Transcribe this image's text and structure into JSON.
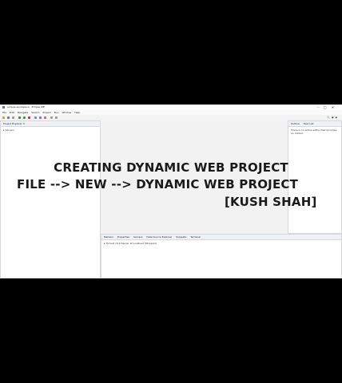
{
  "window": {
    "title": "eclipse-workspace - Eclipse IDE"
  },
  "menu": [
    "File",
    "Edit",
    "Navigate",
    "Search",
    "Project",
    "Run",
    "Window",
    "Help"
  ],
  "project_explorer": {
    "tab_label": "Project Explorer",
    "items": [
      "Servers"
    ]
  },
  "outline": {
    "tabs": [
      "Outline",
      "Task List"
    ],
    "message": "There is no active editor that provides an outline."
  },
  "bottom_panel": {
    "tabs": [
      "Markers",
      "Properties",
      "Servers",
      "Data Source Explorer",
      "Snippets",
      "Terminal"
    ],
    "server_row": "Tomcat v9.0 Server at localhost [Stopped]"
  },
  "overlay": {
    "line1": "CREATING DYNAMIC WEB PROJECT",
    "line2": "FILE --> NEW --> DYNAMIC WEB PROJECT",
    "line3": "[KUSH SHAH]"
  }
}
